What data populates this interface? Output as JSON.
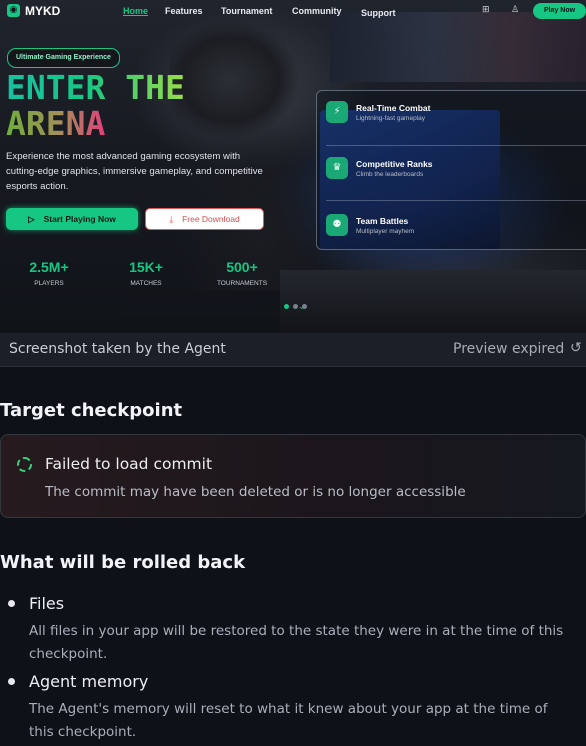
{
  "preview": {
    "nav": {
      "logo": "MYKD",
      "links": [
        "Home",
        "Features",
        "Tournament",
        "Community",
        "Support"
      ],
      "play_label": "Play Now"
    },
    "pill": "Ultimate Gaming Experience",
    "hero_line1": "ENTER THE",
    "hero_line2": "ARENA",
    "description": "Experience the most advanced gaming ecosystem with cutting-edge graphics, immersive gameplay, and competitive esports action.",
    "start_label": "Start Playing Now",
    "download_label": "Free Download",
    "stats": [
      {
        "value": "2.5M+",
        "label": "PLAYERS"
      },
      {
        "value": "15K+",
        "label": "MATCHES"
      },
      {
        "value": "500+",
        "label": "TOURNAMENTS"
      }
    ],
    "features": [
      {
        "title": "Real-Time Combat",
        "subtitle": "Lightning-fast gameplay"
      },
      {
        "title": "Competitive Ranks",
        "subtitle": "Climb the leaderboards"
      },
      {
        "title": "Team Battles",
        "subtitle": "Multiplayer mayhem"
      }
    ],
    "accent": "#16c784"
  },
  "screenshot_bar": {
    "label": "Screenshot taken by the Agent",
    "status": "Preview expired"
  },
  "checkpoint": {
    "heading": "Target checkpoint",
    "title": "Failed to load commit",
    "message": "The commit may have been deleted or is no longer accessible"
  },
  "rollback": {
    "heading": "What will be rolled back",
    "items": [
      {
        "title": "Files",
        "description": "All files in your app will be restored to the state they were in at the time of this checkpoint."
      },
      {
        "title": "Agent memory",
        "description": "The Agent's memory will reset to what it knew about your app at the time of this checkpoint."
      }
    ]
  }
}
